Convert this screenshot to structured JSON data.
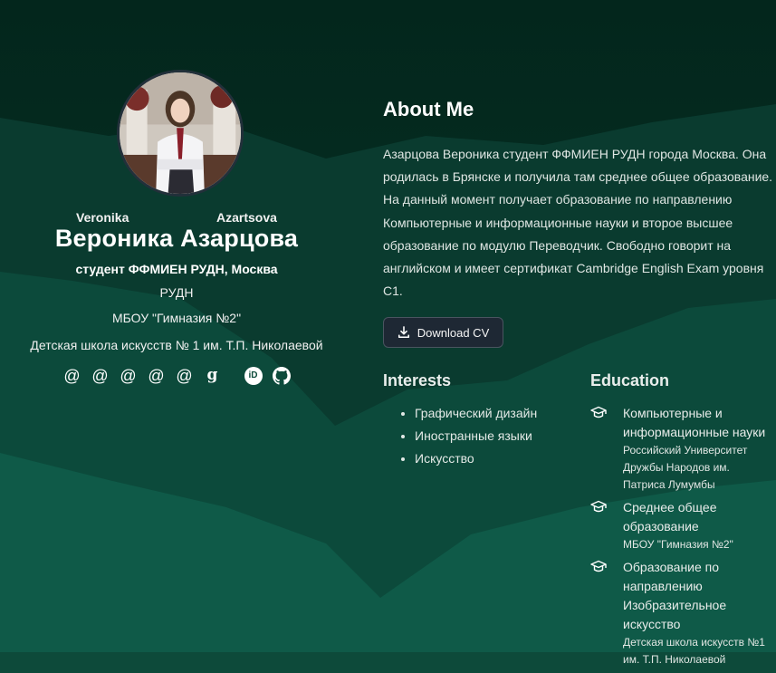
{
  "profile": {
    "first_name_en": "Veronika",
    "last_name_en": "Azartsova",
    "full_name": "Вероника Азарцова",
    "role": "студент ФФМИЕН РУДН, Москва",
    "organizations": [
      "РУДН",
      "МБОУ \"Гимназия №2\"",
      "Детская школа искусств № 1 им. Т.П. Николаевой"
    ],
    "social": [
      {
        "icon": "at-icon",
        "glyph": "@"
      },
      {
        "icon": "at-icon",
        "glyph": "@"
      },
      {
        "icon": "at-icon",
        "glyph": "@"
      },
      {
        "icon": "at-icon",
        "glyph": "@"
      },
      {
        "icon": "at-icon",
        "glyph": "@"
      },
      {
        "icon": "google-scholar-icon",
        "glyph": "g"
      },
      {
        "icon": "orcid-icon",
        "glyph": "iD"
      },
      {
        "icon": "github-icon",
        "glyph": ""
      }
    ]
  },
  "about": {
    "heading": "About Me",
    "text": "Азарцова Вероника студент ФФМИЕН РУДН города Москва. Она родилась в Брянске и получила там среднее общее образование. На данный момент получает образование по направлению Компьютерные и информационные науки и второе высшее образование по модулю Переводчик. Свободно говорит на английском и имеет сертификат Cambridge English Exam уровня С1.",
    "cv_label": "Download CV"
  },
  "interests": {
    "heading": "Interests",
    "items": [
      "Графический дизайн",
      "Иностранные языки",
      "Искусство"
    ]
  },
  "education": {
    "heading": "Education",
    "items": [
      {
        "title_lines": [
          "Компьютерные и",
          "информационные науки"
        ],
        "sub_lines": [
          "Российский Университет",
          "Дружбы Народов им.",
          "Патриса Лумумбы"
        ]
      },
      {
        "title_lines": [
          "Среднее общее",
          "образование"
        ],
        "sub_lines": [
          "МБОУ \"Гимназия №2\""
        ]
      },
      {
        "title_lines": [
          "Образование по",
          "направлению",
          "Изобразительное",
          "искусство"
        ],
        "sub_lines": [
          "Детская школа искусств №1",
          "им. Т.П. Николаевой"
        ]
      }
    ]
  },
  "colors": {
    "top": "#04291f",
    "mid": "#0a3f31",
    "bottom": "#0f5645",
    "button_bg": "#1e2834"
  }
}
